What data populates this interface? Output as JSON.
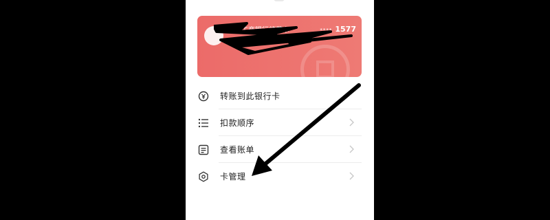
{
  "card": {
    "name": "中国工商银行储蓄卡",
    "type": "借记卡",
    "masked_prefix": "****",
    "last_digits": "1577",
    "bg_color": "#ec6b69"
  },
  "menu": {
    "items": [
      {
        "label": "转账到此银行卡",
        "icon": "yuan-transfer-icon"
      },
      {
        "label": "扣款顺序",
        "icon": "list-icon"
      },
      {
        "label": "查看账单",
        "icon": "bill-icon"
      },
      {
        "label": "卡管理",
        "icon": "gear-icon"
      }
    ]
  },
  "annotation": {
    "arrow_color": "#000000"
  }
}
